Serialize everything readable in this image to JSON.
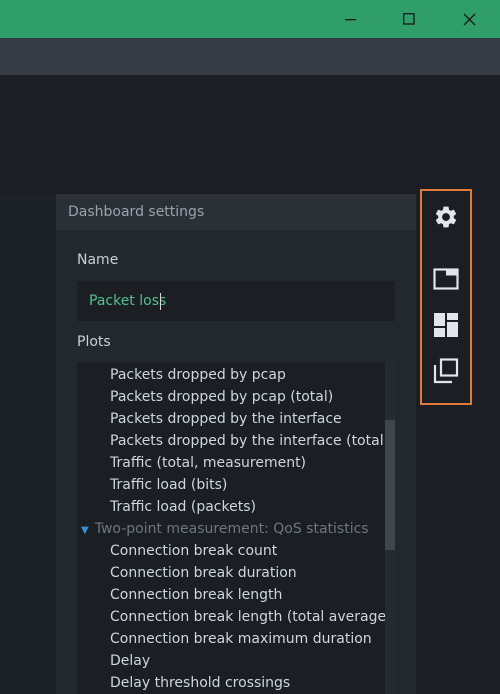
{
  "window": {
    "controls": [
      "minimize-icon",
      "maximize-icon",
      "close-icon"
    ]
  },
  "panel": {
    "title": "Dashboard settings",
    "name_label": "Name",
    "name_value": "Packet loss",
    "plots_label": "Plots",
    "plots": [
      {
        "type": "item",
        "label": "Packets dropped by pcap"
      },
      {
        "type": "item",
        "label": "Packets dropped by pcap (total)"
      },
      {
        "type": "item",
        "label": "Packets dropped by the interface"
      },
      {
        "type": "item",
        "label": "Packets dropped by the interface (total)"
      },
      {
        "type": "item",
        "label": "Traffic (total, measurement)"
      },
      {
        "type": "item",
        "label": "Traffic load (bits)"
      },
      {
        "type": "item",
        "label": "Traffic load (packets)"
      },
      {
        "type": "group",
        "label": "Two-point measurement: QoS statistics"
      },
      {
        "type": "item",
        "label": "Connection break count"
      },
      {
        "type": "item",
        "label": "Connection break duration"
      },
      {
        "type": "item",
        "label": "Connection break length"
      },
      {
        "type": "item",
        "label": "Connection break length (total average)"
      },
      {
        "type": "item",
        "label": "Connection break maximum duration"
      },
      {
        "type": "item",
        "label": "Delay"
      },
      {
        "type": "item",
        "label": "Delay threshold crossings"
      }
    ]
  },
  "side_toolbar": {
    "highlight_color": "#e07a3c",
    "buttons": [
      "gear-icon",
      "window-icon",
      "dashboard-layout-icon",
      "copy-icon"
    ]
  },
  "colors": {
    "titlebar": "#2f9e69",
    "accent_text": "#4fc18a",
    "group_arrow": "#3a8ed6"
  }
}
